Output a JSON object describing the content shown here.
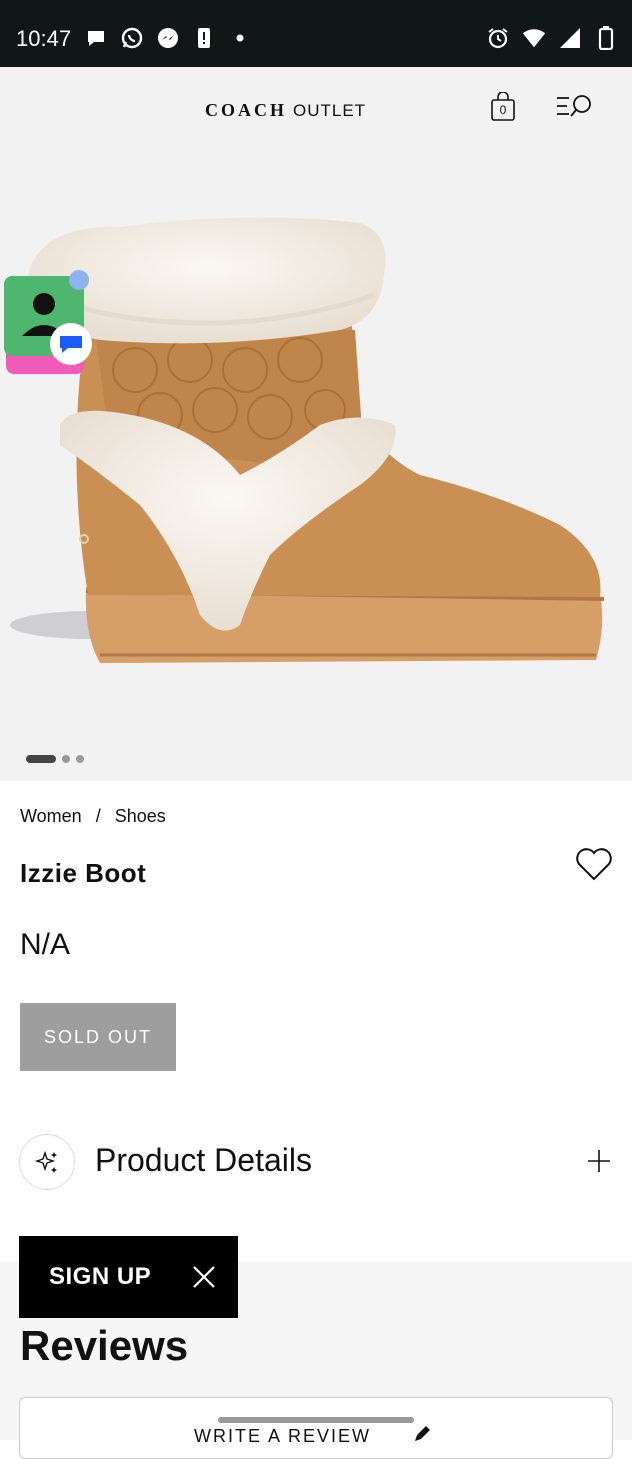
{
  "status_bar": {
    "time": "10:47",
    "left_icons": [
      "chat-icon",
      "whatsapp-icon",
      "messenger-icon",
      "alert-icon",
      "dot-icon"
    ],
    "right_icons": [
      "alarm-icon",
      "wifi-icon",
      "signal-icon",
      "battery-icon"
    ]
  },
  "header": {
    "brand_coach": "COACH",
    "brand_outlet": "OUTLET",
    "bag_count": "0"
  },
  "carousel": {
    "current_index": 1,
    "total": 3
  },
  "breadcrumb": {
    "item1": "Women",
    "separator": "/",
    "item2": "Shoes"
  },
  "product": {
    "title": "Izzie Boot",
    "price": "N/A",
    "status_button": "SOLD OUT"
  },
  "details": {
    "label": "Product Details"
  },
  "signup": {
    "label": "SIGN UP"
  },
  "reviews": {
    "title": "Reviews",
    "write_label": "WRITE A REVIEW"
  },
  "colors": {
    "status_bar_bg": "#111616",
    "hero_bg": "#f2f2f3",
    "sold_out_bg": "#9e9e9e",
    "signup_bg": "#000000",
    "boot_suede": "#c98f53",
    "fur": "#f6f1ea"
  }
}
